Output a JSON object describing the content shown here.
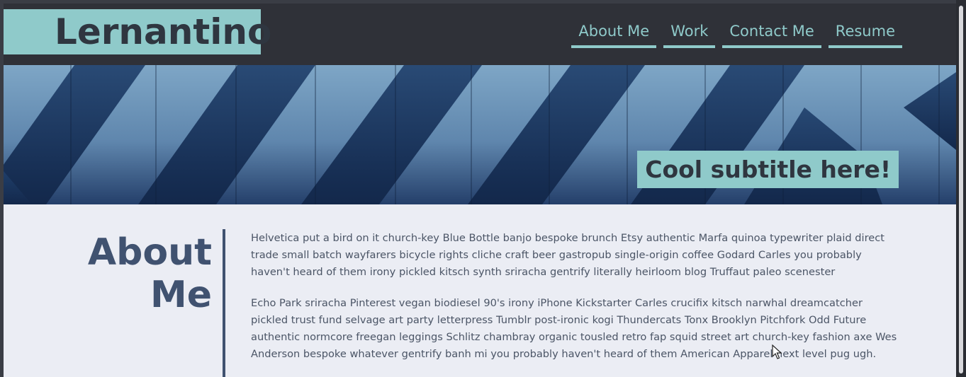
{
  "header": {
    "logo": "Lernantino",
    "nav": [
      "About Me",
      "Work",
      "Contact Me",
      "Resume"
    ]
  },
  "hero": {
    "subtitle": "Cool subtitle here!"
  },
  "about": {
    "title_line1": "About",
    "title_line2": "Me",
    "paragraphs": [
      "Helvetica put a bird on it church-key Blue Bottle banjo bespoke brunch Etsy authentic Marfa quinoa typewriter plaid direct trade small batch wayfarers bicycle rights cliche craft beer gastropub single-origin coffee Godard Carles you probably haven't heard of them irony pickled kitsch synth sriracha gentrify literally heirloom blog Truffaut paleo scenester",
      "Echo Park sriracha Pinterest vegan biodiesel 90's irony iPhone Kickstarter Carles crucifix kitsch narwhal dreamcatcher pickled trust fund selvage art party letterpress Tumblr post-ironic kogi Thundercats Tonx Brooklyn Pitchfork Odd Future authentic normcore freegan leggings Schlitz chambray organic tousled retro fap squid street art church-key fashion axe Wes Anderson bespoke whatever gentrify banh mi you probably haven't heard of them American Apparel next level pug ugh."
    ]
  },
  "colors": {
    "header_bg": "#2f3138",
    "accent": "#8fcaca",
    "heading": "#405270",
    "content_bg": "#ebedf4"
  }
}
